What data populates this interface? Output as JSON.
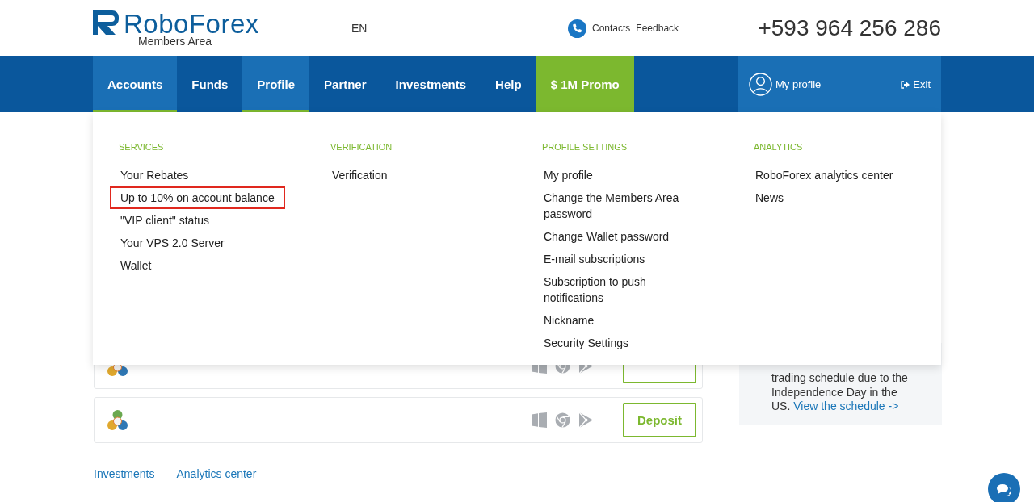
{
  "header": {
    "logo": "RoboForex",
    "logo_sub": "Members Area",
    "language": "EN",
    "contacts": "Contacts",
    "feedback": "Feedback",
    "phone": "+593 964 256 286"
  },
  "nav": {
    "items": [
      {
        "label": "Accounts",
        "selected": true,
        "kind": "tab"
      },
      {
        "label": "Funds",
        "selected": false,
        "kind": "tab"
      },
      {
        "label": "Profile",
        "selected": true,
        "kind": "tab"
      },
      {
        "label": "Partner",
        "selected": false,
        "kind": "tab"
      },
      {
        "label": "Investments",
        "selected": false,
        "kind": "tab"
      },
      {
        "label": "Help",
        "selected": false,
        "kind": "tab"
      },
      {
        "label": "$ 1M Promo",
        "selected": false,
        "kind": "promo"
      }
    ],
    "profile": "My profile",
    "exit": "Exit"
  },
  "menu": {
    "columns": [
      {
        "heading": "SERVICES",
        "items": [
          {
            "label": "Your Rebates",
            "highlighted": false
          },
          {
            "label": "Up to 10% on account balance",
            "highlighted": true
          },
          {
            "label": "\"VIP client\" status",
            "highlighted": false
          },
          {
            "label": "Your VPS 2.0 Server",
            "highlighted": false
          },
          {
            "label": "Wallet",
            "highlighted": false
          }
        ]
      },
      {
        "heading": "VERIFICATION",
        "items": [
          {
            "label": "Verification",
            "highlighted": false
          }
        ]
      },
      {
        "heading": "PROFILE SETTINGS",
        "items": [
          {
            "label": "My profile",
            "highlighted": false
          },
          {
            "label": "Change the Members Area password",
            "highlighted": false
          },
          {
            "label": "Change Wallet password",
            "highlighted": false
          },
          {
            "label": "E-mail subscriptions",
            "highlighted": false
          },
          {
            "label": "Subscription to push notifications",
            "highlighted": false
          },
          {
            "label": "Nickname",
            "highlighted": false
          },
          {
            "label": "Security Settings",
            "highlighted": false
          }
        ]
      },
      {
        "heading": "ANALYTICS",
        "items": [
          {
            "label": "RoboForex analytics center",
            "highlighted": false
          },
          {
            "label": "News",
            "highlighted": false
          }
        ]
      }
    ]
  },
  "accounts": [
    {
      "kind": "covered"
    },
    {
      "kind": "full",
      "deposit": "Deposit"
    }
  ],
  "news": {
    "text": "trading schedule due to the Independence Day in the US.",
    "link": "View the schedule ->"
  },
  "footer_links": [
    "Investments",
    "Analytics center"
  ]
}
